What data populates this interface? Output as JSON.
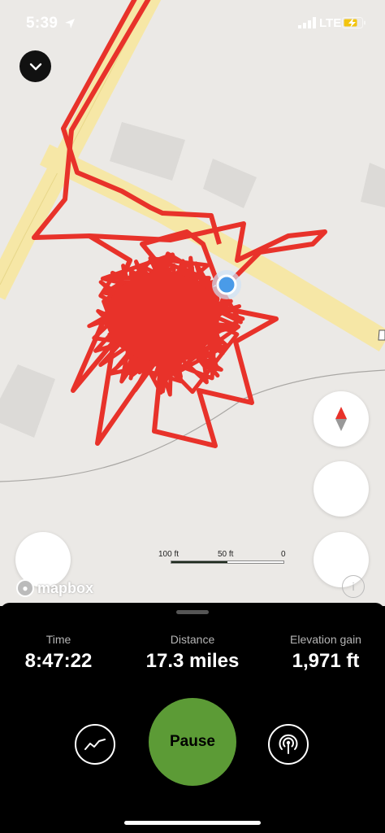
{
  "status_bar": {
    "time": "5:39",
    "network": "LTE",
    "location_icon": "location-arrow-icon",
    "signal_icon": "signal-bars-icon",
    "battery_icon": "battery-charging-icon"
  },
  "map": {
    "collapse_icon": "chevron-down-icon",
    "compass_icon": "compass-icon",
    "scale": {
      "labels": [
        "100 ft",
        "50 ft",
        "0"
      ]
    },
    "attribution": "mapbox",
    "info_label": "i",
    "colors": {
      "track": "#e8322a",
      "road": "#f6e7a6",
      "land": "#ebe9e6",
      "building": "#dcdad7",
      "user_dot": "#4a9be8"
    }
  },
  "stats": [
    {
      "label": "Time",
      "value": "8:47:22"
    },
    {
      "label": "Distance",
      "value": "17.3 miles"
    },
    {
      "label": "Elevation gain",
      "value": "1,971 ft"
    }
  ],
  "controls": {
    "graph_icon": "graph-icon",
    "pause_label": "Pause",
    "pause_color": "#5c9b36",
    "broadcast_icon": "broadcast-icon"
  }
}
